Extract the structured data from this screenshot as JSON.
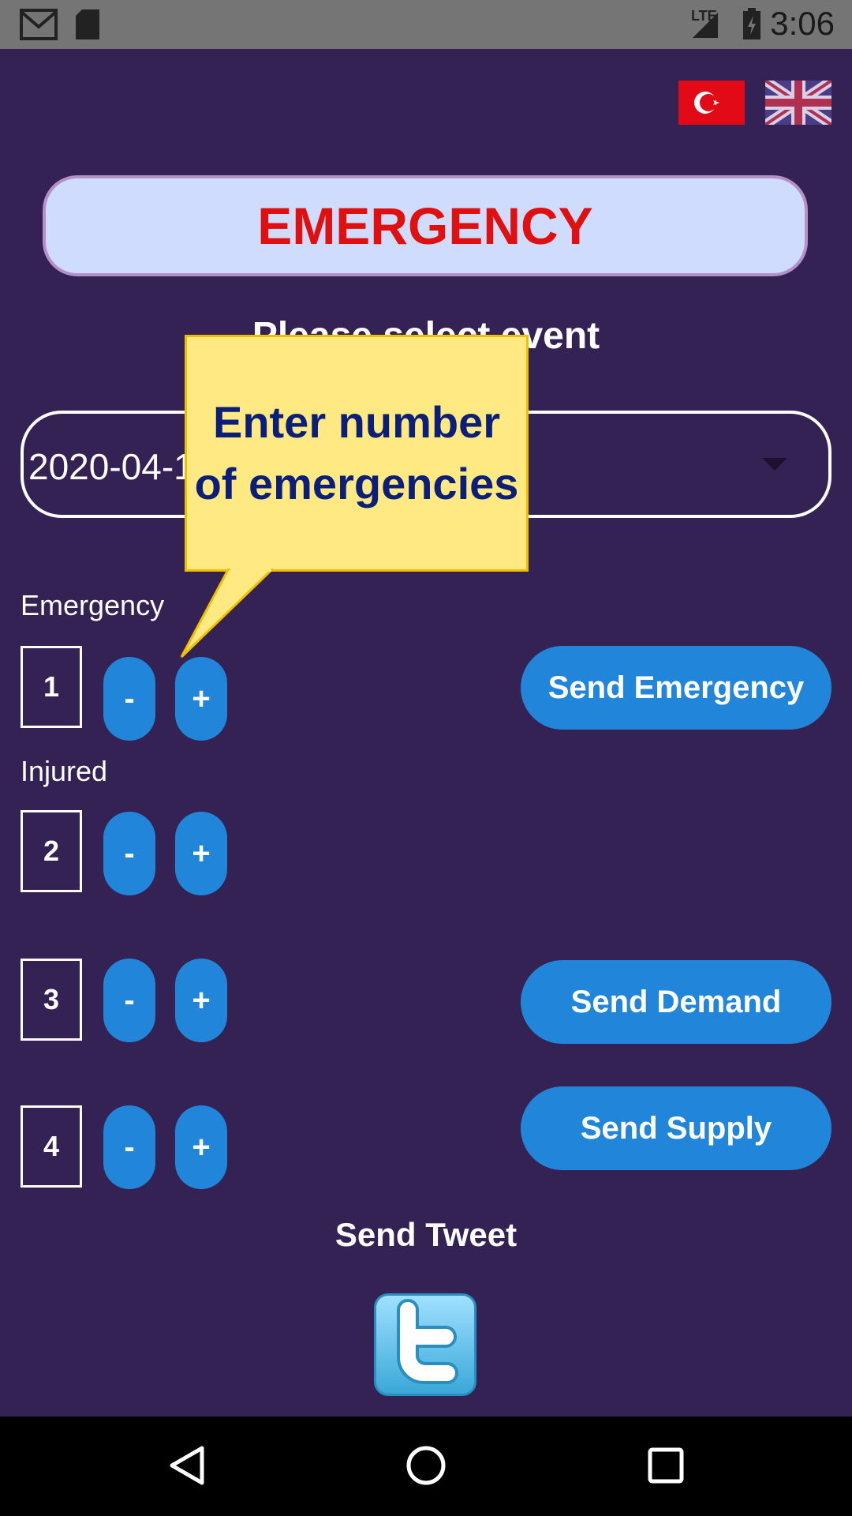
{
  "status_bar": {
    "time": "3:06",
    "network": "LTE"
  },
  "languages": [
    {
      "name": "turkish-flag"
    },
    {
      "name": "uk-flag"
    }
  ],
  "title": "EMERGENCY",
  "subtitle": "Please select event",
  "event_select": {
    "value": "2020-04-1… İstanbul Depr.."
  },
  "tooltip": "Enter number of emergencies",
  "labels": {
    "emergency": "Emergency",
    "injured": "Injured"
  },
  "counters": [
    {
      "value": "1",
      "minus": "-",
      "plus": "+"
    },
    {
      "value": "2",
      "minus": "-",
      "plus": "+"
    },
    {
      "value": "3",
      "minus": "-",
      "plus": "+"
    },
    {
      "value": "4",
      "minus": "-",
      "plus": "+"
    }
  ],
  "actions": {
    "send_emergency": "Send Emergency",
    "send_demand": "Send Demand",
    "send_supply": "Send Supply"
  },
  "tweet_label": "Send Tweet",
  "colors": {
    "background": "#342254",
    "button": "#2186da",
    "title_text": "#e01010",
    "title_box": "#cfdcfd",
    "tooltip_bg": "#ffe983",
    "tooltip_text": "#0b1f7a"
  }
}
